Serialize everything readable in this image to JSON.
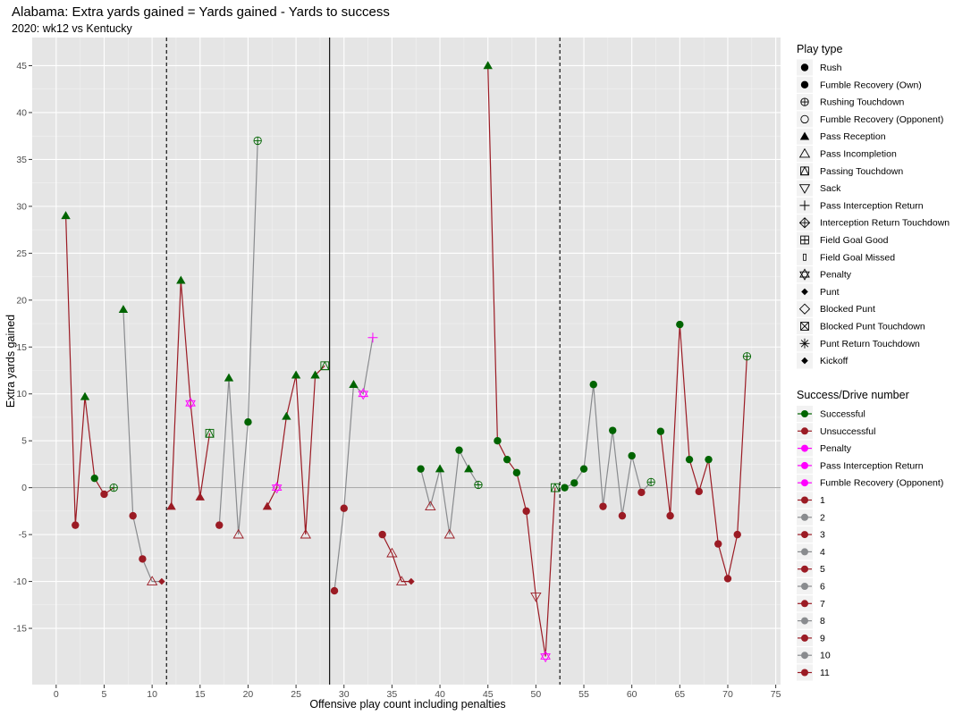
{
  "chart_data": {
    "type": "line",
    "title": "Alabama: Extra yards gained = Yards gained - Yards to success",
    "subtitle": "2020: wk12 vs Kentucky",
    "xlabel": "Offensive play count including penalties",
    "ylabel": "Extra yards gained",
    "xlim": [
      -2.5,
      75.5
    ],
    "ylim": [
      -21,
      48
    ],
    "x_ticks": [
      0,
      5,
      10,
      15,
      20,
      25,
      30,
      35,
      40,
      45,
      50,
      55,
      60,
      65,
      70,
      75
    ],
    "y_ticks": [
      -15,
      -10,
      -5,
      0,
      5,
      10,
      15,
      20,
      25,
      30,
      35,
      40,
      45
    ],
    "grid": true,
    "hlines": [
      0
    ],
    "vlines": [
      {
        "x": 11.5,
        "style": "dashed"
      },
      {
        "x": 28.5,
        "style": "solid"
      },
      {
        "x": 52.5,
        "style": "dashed"
      }
    ],
    "colors": {
      "Successful": "#006400",
      "Unsuccessful": "#9b1b24",
      "Penalty": "#ff00ff",
      "drive_odd": "#9b1b24",
      "drive_even": "#898b8e"
    },
    "points": [
      {
        "x": 1,
        "y": 29,
        "drive": 1,
        "play": "Pass Reception",
        "result": "Successful"
      },
      {
        "x": 2,
        "y": -4,
        "drive": 1,
        "play": "Rush",
        "result": "Unsuccessful"
      },
      {
        "x": 3,
        "y": 9.7,
        "drive": 1,
        "play": "Pass Reception",
        "result": "Successful"
      },
      {
        "x": 4,
        "y": 1,
        "drive": 1,
        "play": "Rush",
        "result": "Successful"
      },
      {
        "x": 5,
        "y": -0.7,
        "drive": 1,
        "play": "Rush",
        "result": "Unsuccessful"
      },
      {
        "x": 6,
        "y": 0,
        "drive": 1,
        "play": "Rushing Touchdown",
        "result": "Successful"
      },
      {
        "x": 7,
        "y": 19,
        "drive": 2,
        "play": "Pass Reception",
        "result": "Successful"
      },
      {
        "x": 8,
        "y": -3,
        "drive": 2,
        "play": "Rush",
        "result": "Unsuccessful"
      },
      {
        "x": 9,
        "y": -7.6,
        "drive": 2,
        "play": "Rush",
        "result": "Unsuccessful"
      },
      {
        "x": 10,
        "y": -10,
        "drive": 2,
        "play": "Pass Incompletion",
        "result": "Unsuccessful"
      },
      {
        "x": 11,
        "y": -10,
        "drive": 2,
        "play": "Punt",
        "result": "Unsuccessful"
      },
      {
        "x": 12,
        "y": -2,
        "drive": 3,
        "play": "Pass Reception",
        "result": "Unsuccessful"
      },
      {
        "x": 13,
        "y": 22.1,
        "drive": 3,
        "play": "Pass Reception",
        "result": "Successful"
      },
      {
        "x": 14,
        "y": 9,
        "drive": 3,
        "play": "Penalty",
        "result": "Penalty"
      },
      {
        "x": 15,
        "y": -1,
        "drive": 3,
        "play": "Pass Reception",
        "result": "Unsuccessful"
      },
      {
        "x": 16,
        "y": 5.8,
        "drive": 3,
        "play": "Passing Touchdown",
        "result": "Successful"
      },
      {
        "x": 17,
        "y": -4,
        "drive": 4,
        "play": "Rush",
        "result": "Unsuccessful"
      },
      {
        "x": 18,
        "y": 11.7,
        "drive": 4,
        "play": "Pass Reception",
        "result": "Successful"
      },
      {
        "x": 19,
        "y": -5,
        "drive": 4,
        "play": "Pass Incompletion",
        "result": "Unsuccessful"
      },
      {
        "x": 20,
        "y": 7,
        "drive": 4,
        "play": "Rush",
        "result": "Successful"
      },
      {
        "x": 21,
        "y": 37,
        "drive": 4,
        "play": "Rushing Touchdown",
        "result": "Successful"
      },
      {
        "x": 22,
        "y": -2,
        "drive": 5,
        "play": "Pass Reception",
        "result": "Unsuccessful"
      },
      {
        "x": 23,
        "y": 0,
        "drive": 5,
        "play": "Penalty",
        "result": "Penalty"
      },
      {
        "x": 24,
        "y": 7.6,
        "drive": 5,
        "play": "Pass Reception",
        "result": "Successful"
      },
      {
        "x": 25,
        "y": 12,
        "drive": 5,
        "play": "Pass Reception",
        "result": "Successful"
      },
      {
        "x": 26,
        "y": -5,
        "drive": 5,
        "play": "Pass Incompletion",
        "result": "Unsuccessful"
      },
      {
        "x": 27,
        "y": 12,
        "drive": 5,
        "play": "Pass Reception",
        "result": "Successful"
      },
      {
        "x": 28,
        "y": 13,
        "drive": 5,
        "play": "Passing Touchdown",
        "result": "Successful"
      },
      {
        "x": 29,
        "y": -11,
        "drive": 6,
        "play": "Rush",
        "result": "Unsuccessful"
      },
      {
        "x": 30,
        "y": -2.2,
        "drive": 6,
        "play": "Rush",
        "result": "Unsuccessful"
      },
      {
        "x": 31,
        "y": 11,
        "drive": 6,
        "play": "Pass Reception",
        "result": "Successful"
      },
      {
        "x": 32,
        "y": 10,
        "drive": 6,
        "play": "Penalty",
        "result": "Penalty"
      },
      {
        "x": 33,
        "y": 16,
        "drive": 6,
        "play": "Pass Interception Return",
        "result": "Pass Interception Return"
      },
      {
        "x": 34,
        "y": -5,
        "drive": 7,
        "play": "Rush",
        "result": "Unsuccessful"
      },
      {
        "x": 35,
        "y": -7,
        "drive": 7,
        "play": "Pass Incompletion",
        "result": "Unsuccessful"
      },
      {
        "x": 36,
        "y": -10,
        "drive": 7,
        "play": "Pass Incompletion",
        "result": "Unsuccessful"
      },
      {
        "x": 37,
        "y": -10,
        "drive": 7,
        "play": "Punt",
        "result": "Unsuccessful"
      },
      {
        "x": 38,
        "y": 2,
        "drive": 8,
        "play": "Rush",
        "result": "Successful"
      },
      {
        "x": 39,
        "y": -2,
        "drive": 8,
        "play": "Pass Incompletion",
        "result": "Unsuccessful"
      },
      {
        "x": 40,
        "y": 2,
        "drive": 8,
        "play": "Pass Reception",
        "result": "Successful"
      },
      {
        "x": 41,
        "y": -5,
        "drive": 8,
        "play": "Pass Incompletion",
        "result": "Unsuccessful"
      },
      {
        "x": 42,
        "y": 4,
        "drive": 8,
        "play": "Rush",
        "result": "Successful"
      },
      {
        "x": 43,
        "y": 2,
        "drive": 8,
        "play": "Pass Reception",
        "result": "Successful"
      },
      {
        "x": 44,
        "y": 0.3,
        "drive": 8,
        "play": "Rushing Touchdown",
        "result": "Successful"
      },
      {
        "x": 45,
        "y": 45,
        "drive": 9,
        "play": "Pass Reception",
        "result": "Successful"
      },
      {
        "x": 46,
        "y": 5,
        "drive": 9,
        "play": "Rush",
        "result": "Successful"
      },
      {
        "x": 47,
        "y": 3,
        "drive": 9,
        "play": "Rush",
        "result": "Successful"
      },
      {
        "x": 48,
        "y": 1.6,
        "drive": 9,
        "play": "Rush",
        "result": "Successful"
      },
      {
        "x": 49,
        "y": -2.5,
        "drive": 9,
        "play": "Rush",
        "result": "Unsuccessful"
      },
      {
        "x": 50,
        "y": -11.6,
        "drive": 9,
        "play": "Sack",
        "result": "Unsuccessful"
      },
      {
        "x": 51,
        "y": -18,
        "drive": 9,
        "play": "Penalty",
        "result": "Penalty"
      },
      {
        "x": 52,
        "y": 0,
        "drive": 9,
        "play": "Passing Touchdown",
        "result": "Successful"
      },
      {
        "x": 53,
        "y": 0,
        "drive": 10,
        "play": "Rush",
        "result": "Successful"
      },
      {
        "x": 54,
        "y": 0.5,
        "drive": 10,
        "play": "Rush",
        "result": "Successful"
      },
      {
        "x": 55,
        "y": 2,
        "drive": 10,
        "play": "Rush",
        "result": "Successful"
      },
      {
        "x": 56,
        "y": 11,
        "drive": 10,
        "play": "Rush",
        "result": "Successful"
      },
      {
        "x": 57,
        "y": -2,
        "drive": 10,
        "play": "Rush",
        "result": "Unsuccessful"
      },
      {
        "x": 58,
        "y": 6.1,
        "drive": 10,
        "play": "Rush",
        "result": "Successful"
      },
      {
        "x": 59,
        "y": -3,
        "drive": 10,
        "play": "Rush",
        "result": "Unsuccessful"
      },
      {
        "x": 60,
        "y": 3.4,
        "drive": 10,
        "play": "Rush",
        "result": "Successful"
      },
      {
        "x": 61,
        "y": -0.5,
        "drive": 10,
        "play": "Rush",
        "result": "Unsuccessful"
      },
      {
        "x": 62,
        "y": 0.6,
        "drive": 10,
        "play": "Rushing Touchdown",
        "result": "Successful"
      },
      {
        "x": 63,
        "y": 6,
        "drive": 11,
        "play": "Rush",
        "result": "Successful"
      },
      {
        "x": 64,
        "y": -3,
        "drive": 11,
        "play": "Rush",
        "result": "Unsuccessful"
      },
      {
        "x": 65,
        "y": 17.4,
        "drive": 11,
        "play": "Rush",
        "result": "Successful"
      },
      {
        "x": 66,
        "y": 3,
        "drive": 11,
        "play": "Rush",
        "result": "Successful"
      },
      {
        "x": 67,
        "y": -0.4,
        "drive": 11,
        "play": "Rush",
        "result": "Unsuccessful"
      },
      {
        "x": 68,
        "y": 3,
        "drive": 11,
        "play": "Rush",
        "result": "Successful"
      },
      {
        "x": 69,
        "y": -6,
        "drive": 11,
        "play": "Rush",
        "result": "Unsuccessful"
      },
      {
        "x": 70,
        "y": -9.7,
        "drive": 11,
        "play": "Rush",
        "result": "Unsuccessful"
      },
      {
        "x": 71,
        "y": -5,
        "drive": 11,
        "play": "Rush",
        "result": "Unsuccessful"
      },
      {
        "x": 72,
        "y": 14,
        "drive": 11,
        "play": "Rushing Touchdown",
        "result": "Successful"
      }
    ],
    "legend_play_type": {
      "title": "Play type",
      "entries": [
        {
          "label": "Rush",
          "shape": "filled-circle"
        },
        {
          "label": "Fumble Recovery (Own)",
          "shape": "filled-circle"
        },
        {
          "label": "Rushing Touchdown",
          "shape": "circle-plus"
        },
        {
          "label": "Fumble Recovery (Opponent)",
          "shape": "open-circle"
        },
        {
          "label": "Pass Reception",
          "shape": "filled-triangle"
        },
        {
          "label": "Pass Incompletion",
          "shape": "open-triangle"
        },
        {
          "label": "Passing Touchdown",
          "shape": "square-triangle"
        },
        {
          "label": "Sack",
          "shape": "open-triangle-down"
        },
        {
          "label": "Pass Interception Return",
          "shape": "plus"
        },
        {
          "label": "Interception Return Touchdown",
          "shape": "diamond-plus"
        },
        {
          "label": "Field Goal Good",
          "shape": "square-plus"
        },
        {
          "label": "Field Goal Missed",
          "shape": "small-rect"
        },
        {
          "label": "Penalty",
          "shape": "star-of-david"
        },
        {
          "label": "Punt",
          "shape": "filled-diamond"
        },
        {
          "label": "Blocked Punt",
          "shape": "open-diamond"
        },
        {
          "label": "Blocked Punt Touchdown",
          "shape": "square-x"
        },
        {
          "label": "Punt Return Touchdown",
          "shape": "asterisk"
        },
        {
          "label": "Kickoff",
          "shape": "filled-diamond"
        }
      ]
    },
    "legend_success": {
      "title": "Success/Drive number",
      "entries": [
        {
          "label": "Successful",
          "color": "#006400"
        },
        {
          "label": "Unsuccessful",
          "color": "#9b1b24"
        },
        {
          "label": "Penalty",
          "color": "#ff00ff"
        },
        {
          "label": "Pass Interception Return",
          "color": "#ff00ff"
        },
        {
          "label": "Fumble Recovery (Opponent)",
          "color": "#ff00ff"
        },
        {
          "label": "1",
          "color": "#9b1b24"
        },
        {
          "label": "2",
          "color": "#898b8e"
        },
        {
          "label": "3",
          "color": "#9b1b24"
        },
        {
          "label": "4",
          "color": "#898b8e"
        },
        {
          "label": "5",
          "color": "#9b1b24"
        },
        {
          "label": "6",
          "color": "#898b8e"
        },
        {
          "label": "7",
          "color": "#9b1b24"
        },
        {
          "label": "8",
          "color": "#898b8e"
        },
        {
          "label": "9",
          "color": "#9b1b24"
        },
        {
          "label": "10",
          "color": "#898b8e"
        },
        {
          "label": "11",
          "color": "#9b1b24"
        }
      ]
    }
  }
}
